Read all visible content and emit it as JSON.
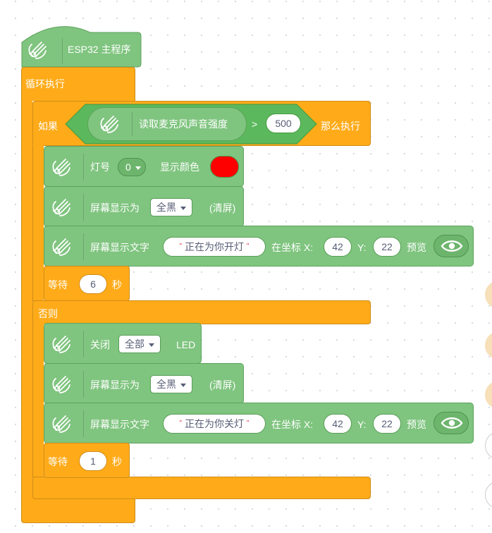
{
  "main_hat": {
    "label": "ESP32 主程序"
  },
  "loop": {
    "label": "循环执行"
  },
  "if_block": {
    "if_label": "如果",
    "sensor_label": "读取麦克风声音强度",
    "operator": ">",
    "threshold": "500",
    "then_label": "那么执行",
    "else_label": "否则"
  },
  "then_blocks": {
    "light": {
      "label": "灯号",
      "number": "0",
      "color_label": "显示颜色",
      "color": "#ff0000"
    },
    "clear": {
      "label": "屏幕显示为",
      "value": "全黑",
      "suffix": "(清屏)"
    },
    "text": {
      "label": "屏幕显示文字",
      "value": "正在为你开灯",
      "coord_label": "在坐标 X:",
      "x": "42",
      "y_label": "Y:",
      "y": "22",
      "preview_label": "预览"
    },
    "wait": {
      "label": "等待",
      "value": "6",
      "unit": "秒"
    }
  },
  "else_blocks": {
    "off": {
      "label": "关闭",
      "value": "全部",
      "suffix": "LED"
    },
    "clear": {
      "label": "屏幕显示为",
      "value": "全黑",
      "suffix": "(清屏)"
    },
    "text": {
      "label": "屏幕显示文字",
      "value": "正在为你关灯",
      "coord_label": "在坐标 X:",
      "x": "42",
      "y_label": "Y:",
      "y": "22",
      "preview_label": "预览"
    },
    "wait": {
      "label": "等待",
      "value": "1",
      "unit": "秒"
    }
  },
  "colors": {
    "control": "#ffab19",
    "esp32": "#7fc47f",
    "operator": "#5cb85c"
  },
  "icons": {
    "block_icon": "esp32-wave-icon",
    "preview_icon": "eye-icon"
  }
}
